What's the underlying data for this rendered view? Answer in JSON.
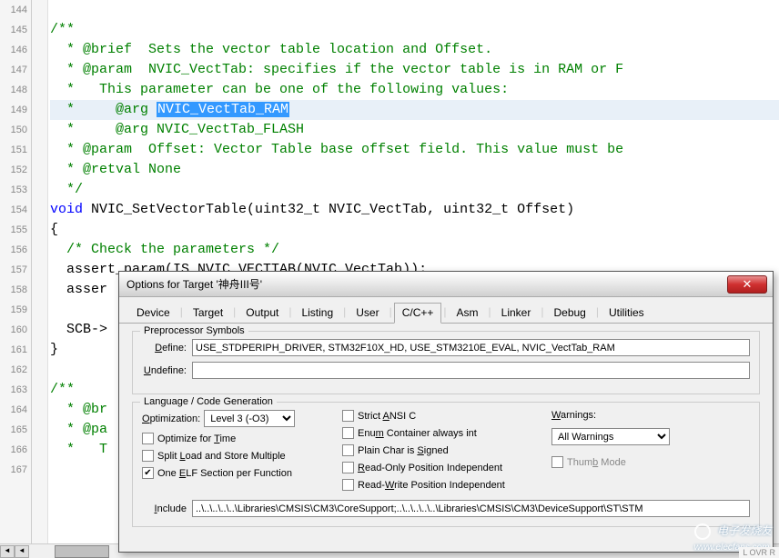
{
  "editor": {
    "lines": [
      {
        "num": "144",
        "segments": [
          {
            "cls": "text",
            "txt": " "
          }
        ]
      },
      {
        "num": "145",
        "segments": [
          {
            "cls": "comment",
            "txt": "/**"
          }
        ]
      },
      {
        "num": "146",
        "segments": [
          {
            "cls": "comment",
            "txt": "  * @brief  Sets the vector table location and Offset."
          }
        ]
      },
      {
        "num": "147",
        "segments": [
          {
            "cls": "comment",
            "txt": "  * @param  NVIC_VectTab: specifies if the vector table is in RAM or F"
          }
        ]
      },
      {
        "num": "148",
        "segments": [
          {
            "cls": "comment",
            "txt": "  *   This parameter can be one of the following values:"
          }
        ]
      },
      {
        "num": "149",
        "current": true,
        "segments": [
          {
            "cls": "comment",
            "txt": "  *     @arg "
          },
          {
            "cls": "highlight",
            "txt": "NVIC_VectTab_RAM"
          }
        ]
      },
      {
        "num": "150",
        "segments": [
          {
            "cls": "comment",
            "txt": "  *     @arg NVIC_VectTab_FLASH"
          }
        ]
      },
      {
        "num": "151",
        "segments": [
          {
            "cls": "comment",
            "txt": "  * @param  Offset: Vector Table base offset field. This value must be"
          }
        ]
      },
      {
        "num": "152",
        "segments": [
          {
            "cls": "comment",
            "txt": "  * @retval None"
          }
        ]
      },
      {
        "num": "153",
        "segments": [
          {
            "cls": "comment",
            "txt": "  */"
          }
        ]
      },
      {
        "num": "154",
        "segments": [
          {
            "cls": "keyword",
            "txt": "void"
          },
          {
            "cls": "text",
            "txt": " NVIC_SetVectorTable(uint32_t NVIC_VectTab, uint32_t Offset)"
          }
        ]
      },
      {
        "num": "155",
        "segments": [
          {
            "cls": "text",
            "txt": "{"
          }
        ]
      },
      {
        "num": "156",
        "segments": [
          {
            "cls": "text",
            "txt": "  "
          },
          {
            "cls": "comment",
            "txt": "/* Check the parameters */"
          }
        ]
      },
      {
        "num": "157",
        "segments": [
          {
            "cls": "text",
            "txt": "  assert_param(IS_NVIC_VECTTAB(NVIC_VectTab));"
          }
        ]
      },
      {
        "num": "158",
        "segments": [
          {
            "cls": "text",
            "txt": "  asser"
          }
        ]
      },
      {
        "num": "159",
        "segments": [
          {
            "cls": "text",
            "txt": "  "
          }
        ]
      },
      {
        "num": "160",
        "segments": [
          {
            "cls": "text",
            "txt": "  SCB->"
          }
        ]
      },
      {
        "num": "161",
        "segments": [
          {
            "cls": "text",
            "txt": "}"
          }
        ]
      },
      {
        "num": "162",
        "segments": [
          {
            "cls": "text",
            "txt": " "
          }
        ]
      },
      {
        "num": "163",
        "segments": [
          {
            "cls": "comment",
            "txt": "/**"
          }
        ]
      },
      {
        "num": "164",
        "segments": [
          {
            "cls": "comment",
            "txt": "  * @br                                                                   r mo"
          }
        ]
      },
      {
        "num": "165",
        "segments": [
          {
            "cls": "comment",
            "txt": "  * @pa                                                                   o ent"
          }
        ]
      },
      {
        "num": "166",
        "segments": [
          {
            "cls": "comment",
            "txt": "  *   T"
          }
        ]
      },
      {
        "num": "167",
        "segments": [
          {
            "cls": "text",
            "txt": " "
          }
        ]
      }
    ]
  },
  "dialog": {
    "title": "Options for Target '神舟III号'",
    "close": "✕",
    "tabs": [
      "Device",
      "Target",
      "Output",
      "Listing",
      "User",
      "C/C++",
      "Asm",
      "Linker",
      "Debug",
      "Utilities"
    ],
    "active_tab": 5,
    "preproc": {
      "legend": "Preprocessor Symbols",
      "define_label": "Define:",
      "define_value": "USE_STDPERIPH_DRIVER, STM32F10X_HD, USE_STM3210E_EVAL, NVIC_VectTab_RAM",
      "undefine_label": "Undefine:",
      "undefine_value": ""
    },
    "lang": {
      "legend": "Language / Code Generation",
      "optimization_label": "Optimization:",
      "optimization_value": "Level 3 (-O3)",
      "optimize_time": "Optimize for Time",
      "split_load": "Split Load and Store Multiple",
      "one_elf": "One ELF Section per Function",
      "strict_ansi": "Strict ANSI C",
      "enum_container": "Enum Container always int",
      "plain_char": "Plain Char is Signed",
      "readonly_pos": "Read-Only Position Independent",
      "readwrite_pos": "Read-Write Position Independent",
      "warnings_label": "Warnings:",
      "warnings_value": "All Warnings",
      "thumb_mode": "Thumb Mode",
      "include_label": "Include",
      "include_value": "..\\..\\..\\..\\..\\Libraries\\CMSIS\\CM3\\CoreSupport;..\\..\\..\\..\\..\\Libraries\\CMSIS\\CM3\\DeviceSupport\\ST\\STM"
    }
  },
  "watermark": "电子发烧友",
  "watermark_url": "www.elecfans.com",
  "status_remnant": "L OVR R"
}
